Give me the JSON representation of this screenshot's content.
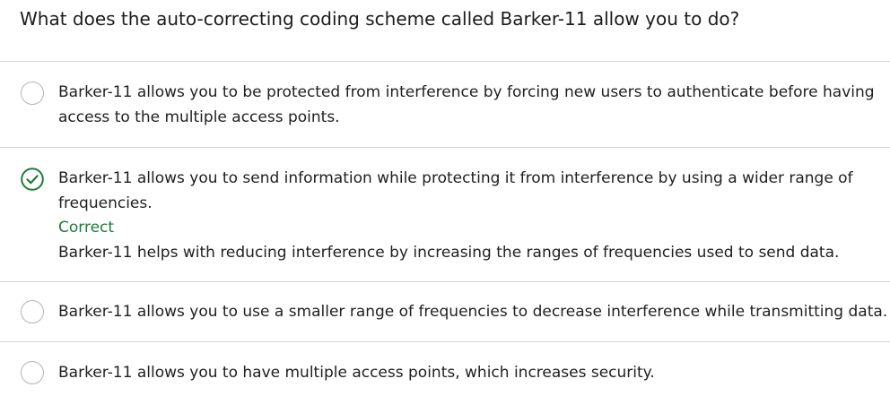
{
  "question": {
    "text": "What does the auto-correcting coding scheme called Barker-11 allow you to do?"
  },
  "options": [
    {
      "text": "Barker-11 allows you to be protected from interference by forcing new users to authenticate before having access to the multiple access points.",
      "selected": false
    },
    {
      "text": "Barker-11 allows you to send information while protecting it from interference by using a wider range of frequencies.",
      "selected": true,
      "feedback_title": "Correct",
      "feedback_body": "Barker-11 helps with reducing interference by increasing the ranges of frequencies used to send data."
    },
    {
      "text": "Barker-11 allows you to use a smaller range of frequencies to decrease interference while transmitting data.",
      "selected": false
    },
    {
      "text": "Barker-11 allows you to have multiple access points, which increases security.",
      "selected": false
    }
  ],
  "colors": {
    "correct": "#1e7b3a",
    "divider": "#d3d3d3",
    "radio_border": "#b5b5b5"
  },
  "icons": {
    "correct": "check-circle-icon"
  }
}
